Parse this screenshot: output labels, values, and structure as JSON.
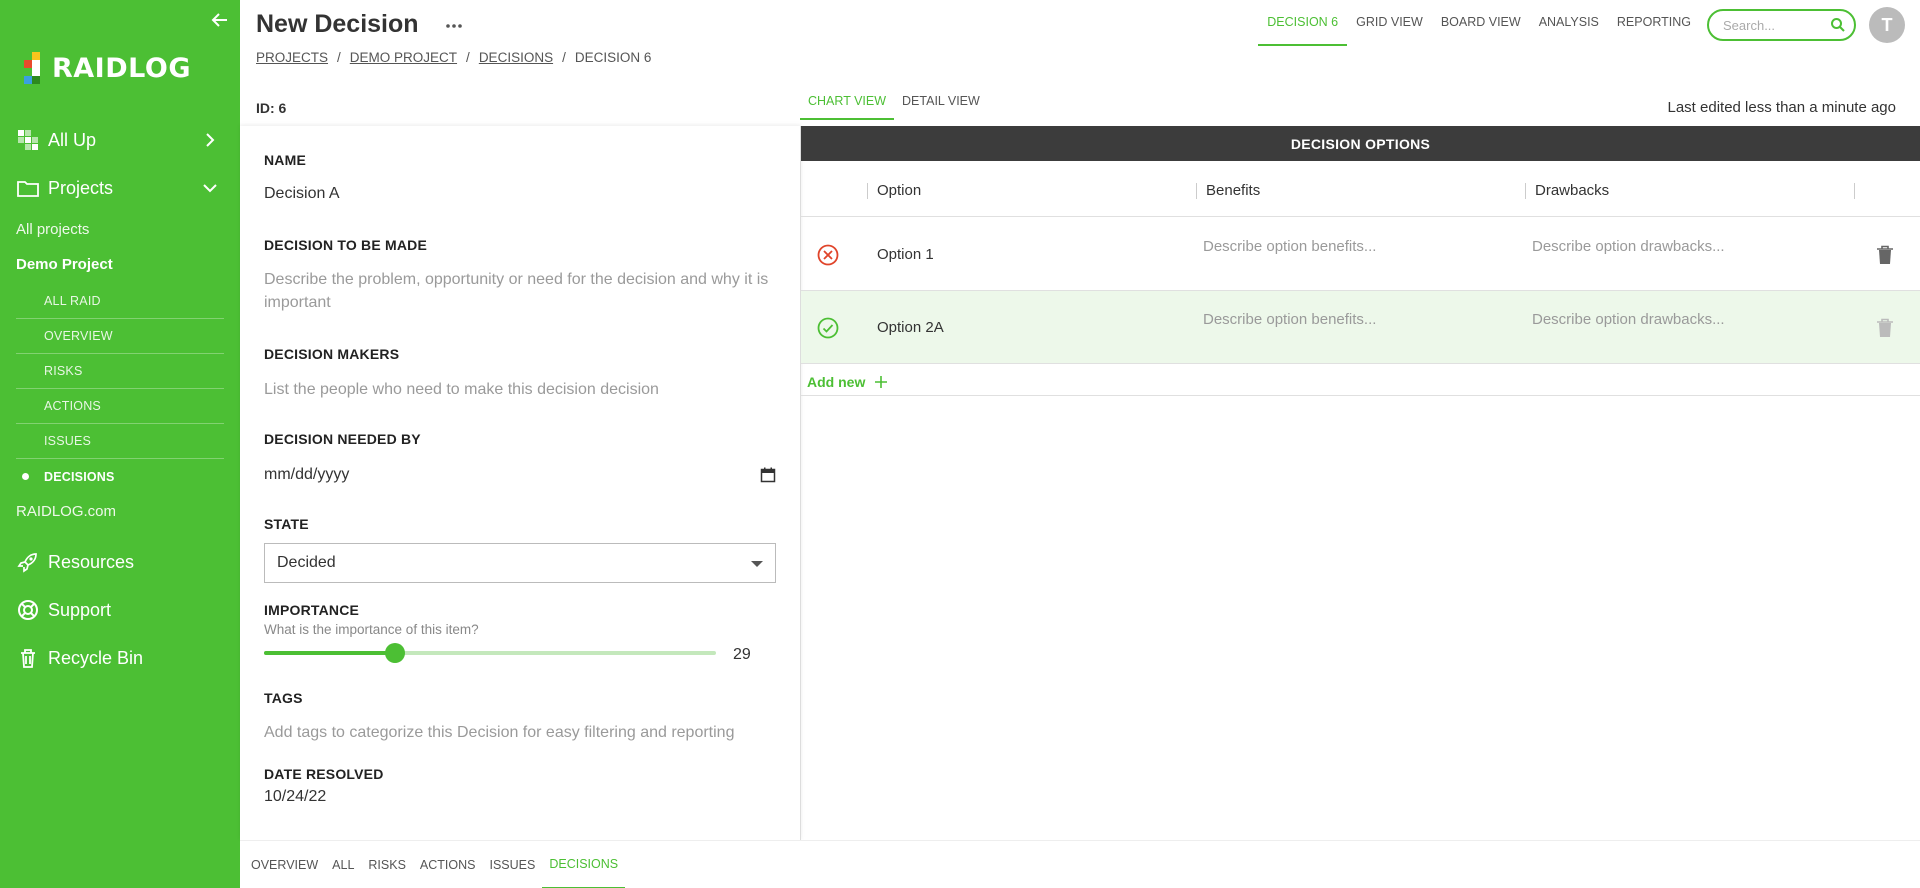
{
  "app": {
    "logo_text": "RAIDLOG",
    "brand_color": "#4cbf34"
  },
  "sidebar": {
    "all_up": "All Up",
    "projects": "Projects",
    "all_projects": "All projects",
    "current_project": "Demo Project",
    "sub_items": [
      "ALL RAID",
      "OVERVIEW",
      "RISKS",
      "ACTIONS",
      "ISSUES",
      "DECISIONS"
    ],
    "active_sub_item": "DECISIONS",
    "raidlog_link": "RAIDLOG.com",
    "resources": "Resources",
    "support": "Support",
    "recycle_bin": "Recycle Bin"
  },
  "header": {
    "title": "New Decision",
    "breadcrumb": [
      "PROJECTS",
      "DEMO PROJECT",
      "DECISIONS",
      "DECISION 6"
    ],
    "tabs": [
      "DECISION 6",
      "GRID VIEW",
      "BOARD VIEW",
      "ANALYSIS",
      "REPORTING"
    ],
    "active_tab": "DECISION 6",
    "search_placeholder": "Search...",
    "avatar_initial": "T"
  },
  "record": {
    "id_label": "ID: 6",
    "view_tabs": [
      "CHART VIEW",
      "DETAIL VIEW"
    ],
    "active_view": "CHART VIEW",
    "last_edited": "Last edited less than a minute ago"
  },
  "form": {
    "name_label": "NAME",
    "name_value": "Decision A",
    "decision_label": "DECISION TO BE MADE",
    "decision_placeholder": "Describe the problem, opportunity or need for the decision and why it is important",
    "makers_label": "DECISION MAKERS",
    "makers_placeholder": "List the people who need to make this decision decision",
    "needed_by_label": "DECISION NEEDED BY",
    "needed_by_value": "mm/dd/yyyy",
    "state_label": "STATE",
    "state_value": "Decided",
    "importance_label": "IMPORTANCE",
    "importance_help": "What is the importance of this item?",
    "importance_value": 29,
    "importance_max": 100,
    "tags_label": "TAGS",
    "tags_placeholder": "Add tags to categorize this Decision for easy filtering and reporting",
    "resolved_label": "DATE RESOLVED",
    "resolved_value": "10/24/22"
  },
  "options": {
    "header": "DECISION OPTIONS",
    "columns": [
      "Option",
      "Benefits",
      "Drawbacks"
    ],
    "rows": [
      {
        "name": "Option 1",
        "status": "rejected",
        "benefits": "Describe option benefits...",
        "drawbacks": "Describe option drawbacks..."
      },
      {
        "name": "Option 2A",
        "status": "accepted",
        "benefits": "Describe option benefits...",
        "drawbacks": "Describe option drawbacks..."
      }
    ],
    "add_new": "Add new",
    "rejected_color": "#e0442a",
    "accepted_color": "#4cbf34"
  },
  "bottom_tabs": [
    "OVERVIEW",
    "ALL",
    "RISKS",
    "ACTIONS",
    "ISSUES",
    "DECISIONS"
  ],
  "bottom_active": "DECISIONS"
}
